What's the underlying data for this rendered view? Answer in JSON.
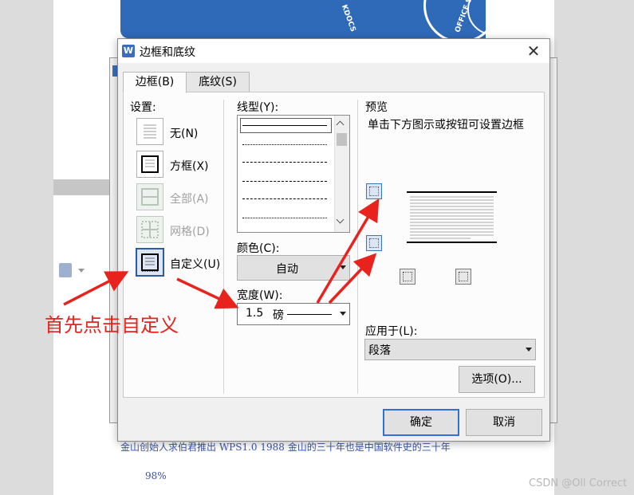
{
  "dialog": {
    "title": "边框和底纹",
    "app_icon": "W",
    "tabs": [
      "边框(B)",
      "底纹(S)"
    ],
    "settings_label": "设置:",
    "settings": [
      {
        "label": "无(N)",
        "icon": "none-border-icon",
        "enabled": true
      },
      {
        "label": "方框(X)",
        "icon": "box-border-icon",
        "enabled": true
      },
      {
        "label": "全部(A)",
        "icon": "all-border-icon",
        "enabled": false
      },
      {
        "label": "网格(D)",
        "icon": "grid-border-icon",
        "enabled": false
      },
      {
        "label": "自定义(U)",
        "icon": "custom-border-icon",
        "enabled": true,
        "selected": true
      }
    ],
    "line_style_label": "线型(Y):",
    "color_label": "颜色(C):",
    "color_value": "自动",
    "width_label": "宽度(W):",
    "width_value": "1.5",
    "width_unit": "磅",
    "preview_label": "预览",
    "preview_hint": "单击下方图示或按钮可设置边框",
    "apply_label": "应用于(L):",
    "apply_value": "段落",
    "options_button": "选项(O)...",
    "ok_button": "确定",
    "cancel_button": "取消"
  },
  "annotation": {
    "text": "首先点击自定义",
    "color": "#e8231e"
  },
  "document": {
    "line1": "金山创始人求伯君推出 WPS1.0  1988 金山的三十年也是中国软件史的三十年",
    "zoom": "98%",
    "banner_text": "KDOCS",
    "banner_text2": "OFFICE S"
  },
  "watermark": "CSDN @Oll Correct",
  "colors": {
    "accent": "#2f72cf",
    "arrow": "#e8231e"
  }
}
